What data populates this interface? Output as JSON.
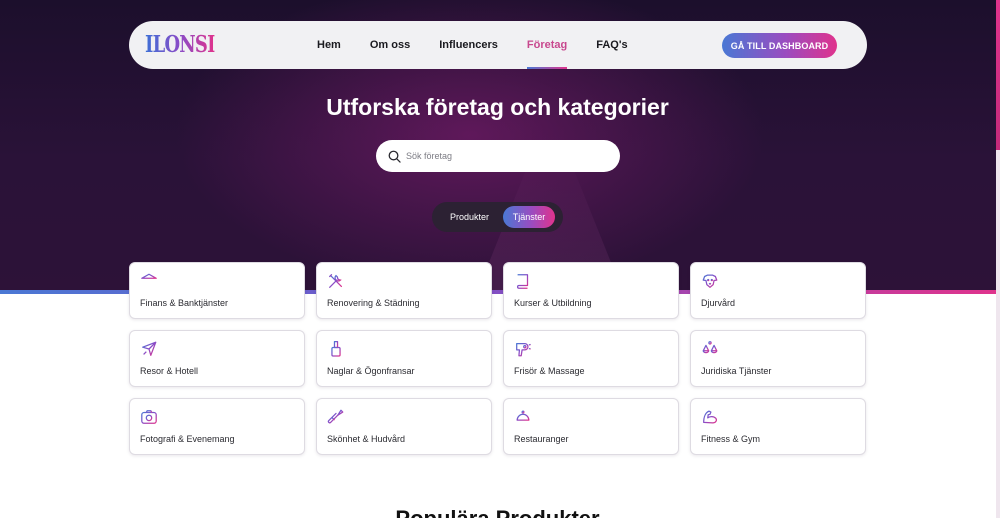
{
  "colors": {
    "accent_blue": "#4a78d4",
    "accent_pink": "#e0338c",
    "hero_dark": "#24112f",
    "active_nav": "#c8488e"
  },
  "nav": {
    "logo_text": "ILONSI",
    "links": [
      {
        "label": "Hem",
        "active": false
      },
      {
        "label": "Om oss",
        "active": false
      },
      {
        "label": "Influencers",
        "active": false
      },
      {
        "label": "Företag",
        "active": true
      },
      {
        "label": "FAQ's",
        "active": false
      }
    ],
    "cta_label": "GÅ TILL DASHBOARD"
  },
  "hero": {
    "title": "Utforska företag och kategorier",
    "search_placeholder": "Sök företag",
    "search_icon": "search-icon",
    "toggle": {
      "options": [
        "Produkter",
        "Tjänster"
      ],
      "selected": "Tjänster"
    }
  },
  "categories": [
    {
      "label": "Finans & Banktjänster",
      "icon": "bank-icon"
    },
    {
      "label": "Renovering & Städning",
      "icon": "tools-icon"
    },
    {
      "label": "Kurser & Utbildning",
      "icon": "book-icon"
    },
    {
      "label": "Djurvård",
      "icon": "pet-icon"
    },
    {
      "label": "Resor & Hotell",
      "icon": "airplane-icon"
    },
    {
      "label": "Naglar & Ögonfransar",
      "icon": "nail-polish-icon"
    },
    {
      "label": "Frisör & Massage",
      "icon": "hair-dryer-icon"
    },
    {
      "label": "Juridiska Tjänster",
      "icon": "scales-icon"
    },
    {
      "label": "Fotografi & Evenemang",
      "icon": "camera-icon"
    },
    {
      "label": "Skönhet & Hudvård",
      "icon": "makeup-brush-icon"
    },
    {
      "label": "Restauranger",
      "icon": "cloche-icon"
    },
    {
      "label": "Fitness & Gym",
      "icon": "arm-muscle-icon"
    }
  ],
  "next_section_title": "Populära Produkter"
}
